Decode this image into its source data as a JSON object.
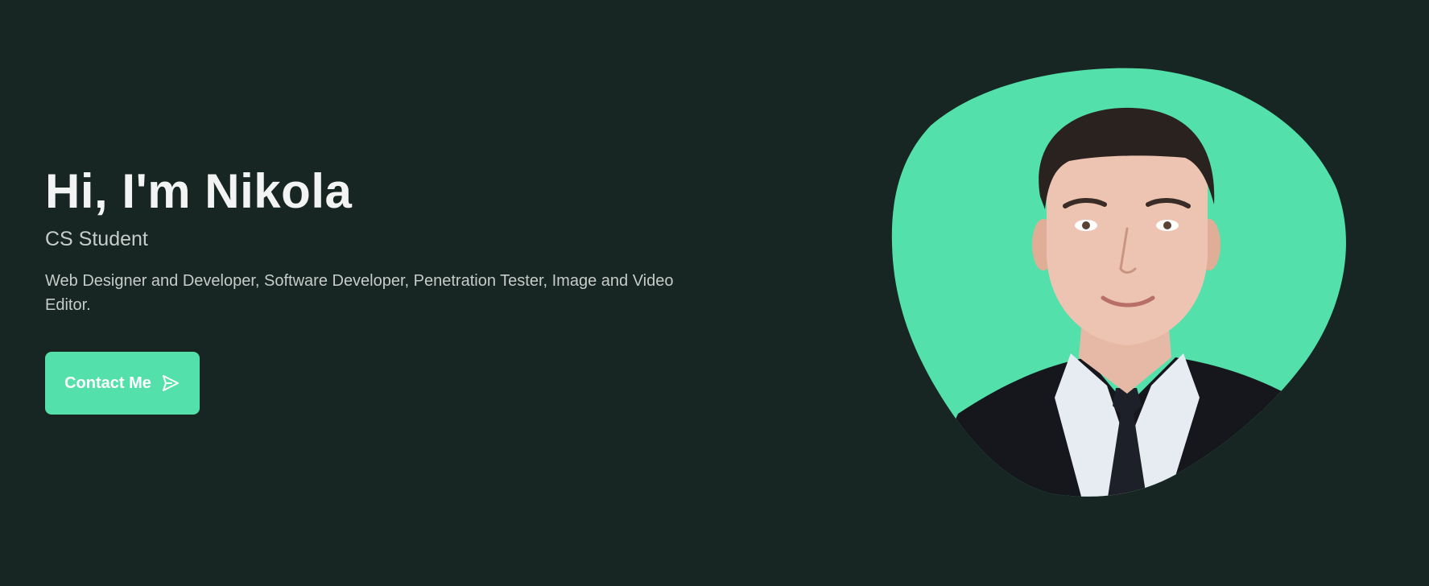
{
  "hero": {
    "title": "Hi, I'm Nikola",
    "subtitle": "CS Student",
    "description": "Web Designer and Developer, Software Developer, Penetration Tester, Image and Video Editor.",
    "contact_label": "Contact Me",
    "contact_icon": "send-icon"
  },
  "portrait": {
    "icon": "profile-photo"
  },
  "colors": {
    "background": "#172622",
    "accent": "#53e0aa",
    "heading": "#f2f4f3",
    "body_text": "#c5ccc9"
  }
}
